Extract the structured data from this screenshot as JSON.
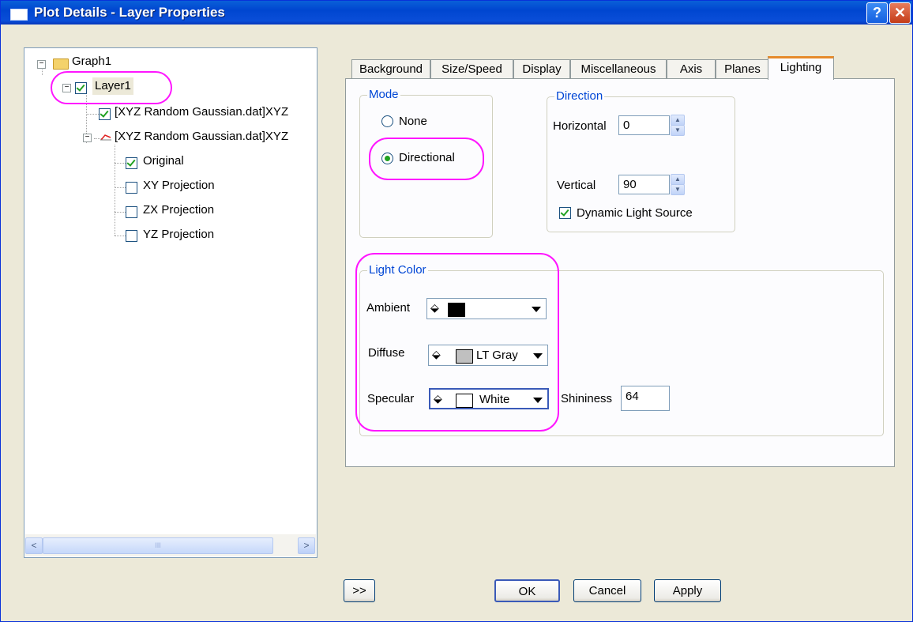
{
  "window": {
    "title": "Plot Details - Layer Properties",
    "help_label": "?",
    "close_label": "✕"
  },
  "tree": {
    "root": "Graph1",
    "layer": "Layer1",
    "plot1": "[XYZ Random Gaussian.dat]XYZ",
    "plot2": "[XYZ Random Gaussian.dat]XYZ",
    "sub_items": [
      "Original",
      "XY Projection",
      "ZX Projection",
      "YZ Projection"
    ],
    "scroll_left": "<",
    "scroll_right": ">",
    "scroll_grip": "III"
  },
  "tabs": [
    "Background",
    "Size/Speed",
    "Display",
    "Miscellaneous",
    "Axis",
    "Planes",
    "Lighting"
  ],
  "active_tab": "Lighting",
  "mode": {
    "label": "Mode",
    "options": [
      "None",
      "Directional"
    ],
    "selected": "Directional"
  },
  "direction": {
    "label": "Direction",
    "horizontal_label": "Horizontal",
    "horizontal_value": "0",
    "vertical_label": "Vertical",
    "vertical_value": "90",
    "dynamic_label": "Dynamic Light Source",
    "dynamic_checked": true
  },
  "light_color": {
    "label": "Light Color",
    "ambient_label": "Ambient",
    "ambient_value": "",
    "ambient_color": "#000000",
    "diffuse_label": "Diffuse",
    "diffuse_value": "LT Gray",
    "diffuse_color": "#c0c0c0",
    "specular_label": "Specular",
    "specular_value": "White",
    "specular_color": "#ffffff",
    "shininess_label": "Shininess",
    "shininess_value": "64"
  },
  "buttons": {
    "more": ">>",
    "ok": "OK",
    "cancel": "Cancel",
    "apply": "Apply"
  },
  "colors": {
    "highlight": "#ff16ff",
    "title_bar": "#0046d0",
    "group_label": "#0046d5",
    "active_tab_accent": "#e68b2c"
  }
}
